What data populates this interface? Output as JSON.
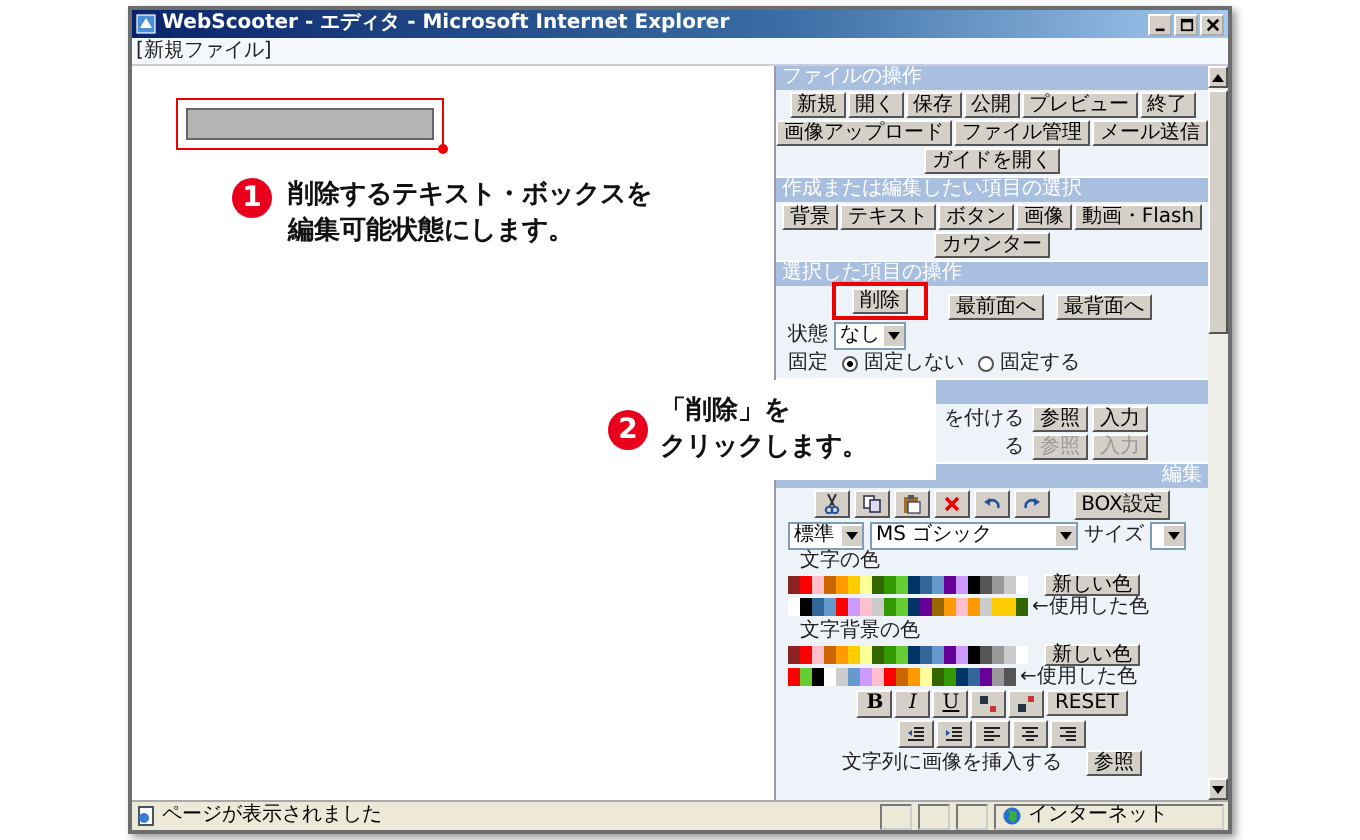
{
  "window": {
    "title": "WebScooter - エディタ - Microsoft Internet Explorer"
  },
  "file_label": "[新規ファイル]",
  "canvas": {
    "textbox": {
      "highlighted": true
    }
  },
  "callouts": [
    {
      "number": "1",
      "lines": [
        "削除するテキスト・ボックスを",
        "編集可能状態にします。"
      ]
    },
    {
      "number": "2",
      "lines": [
        "「削除」を",
        "クリックします。"
      ]
    }
  ],
  "file_section": {
    "title": "ファイルの操作",
    "button_rows": [
      [
        "新規",
        "開く",
        "保存",
        "公開",
        "プレビュー",
        "終了"
      ],
      [
        "画像アップロード",
        "ファイル管理",
        "メール送信"
      ],
      [
        "ガイドを開く"
      ]
    ]
  },
  "item_section": {
    "title": "作成または編集したい項目の選択",
    "button_rows": [
      [
        "背景",
        "テキスト",
        "ボタン",
        "画像",
        "動画・Flash"
      ],
      [
        "カウンター"
      ]
    ]
  },
  "operation_section": {
    "title": "選択した項目の操作",
    "buttons": [
      {
        "label": "削除",
        "highlighted": true
      },
      {
        "label": "最前面へ",
        "highlighted": false
      },
      {
        "label": "最背面へ",
        "highlighted": false
      }
    ],
    "state_label": "状態",
    "state_value": "なし",
    "fixed_label": "固定",
    "fixed_options": [
      {
        "label": "固定しない",
        "selected": true
      },
      {
        "label": "固定する",
        "selected": false
      }
    ]
  },
  "link_section": {
    "rows": [
      {
        "label": "を付ける",
        "buttons": [
          {
            "label": "参照",
            "disabled": false
          },
          {
            "label": "入力",
            "disabled": false
          }
        ]
      },
      {
        "label": "る",
        "buttons": [
          {
            "label": "参照",
            "disabled": true
          },
          {
            "label": "入力",
            "disabled": true
          }
        ]
      }
    ]
  },
  "edit_section": {
    "title": "編集",
    "box_button": "BOX設定",
    "style_select": "標準",
    "font_select": "MS ゴシック",
    "size_label": "サイズ",
    "color_groups": [
      {
        "label": "文字の色",
        "new_button": "新しい色",
        "used_label": "←使用した色",
        "palette": [
          {
            "color": "#8b2323"
          },
          {
            "color": "#ff0000"
          },
          {
            "color": "#ffc0cb"
          },
          {
            "color": "#cc6600"
          },
          {
            "color": "#ff9900"
          },
          {
            "color": "#ffcc00"
          },
          {
            "color": "#ffff99"
          },
          {
            "color": "#336600"
          },
          {
            "color": "#339900"
          },
          {
            "color": "#66cc33"
          },
          {
            "color": "#003366"
          },
          {
            "color": "#336699"
          },
          {
            "color": "#6699cc"
          },
          {
            "color": "#660099"
          },
          {
            "color": "#cc99ff"
          },
          {
            "color": "#000000"
          },
          {
            "color": "#555555"
          },
          {
            "color": "#999999"
          },
          {
            "color": "#cccccc"
          },
          {
            "color": "#ffffff"
          }
        ],
        "used": [
          {
            "color": "#ffffff"
          },
          {
            "color": "#000000"
          },
          {
            "color": "#336699"
          },
          {
            "color": "#6699cc"
          },
          {
            "color": "#ff0000"
          },
          {
            "color": "#cc99ff"
          },
          {
            "color": "#ffc0cb"
          },
          {
            "color": "#cccccc"
          },
          {
            "color": "#339900"
          },
          {
            "color": "#66cc33"
          },
          {
            "color": "#003366"
          },
          {
            "color": "#660099"
          },
          {
            "color": "#996600"
          },
          {
            "color": "#ff9900"
          },
          {
            "color": "#ffc0cb"
          },
          {
            "color": "#ff9900"
          },
          {
            "color": "#cccccc"
          },
          {
            "color": "#ffcc00"
          },
          {
            "color": "#ffcc00"
          },
          {
            "color": "#336600"
          }
        ]
      },
      {
        "label": "文字背景の色",
        "new_button": "新しい色",
        "used_label": "←使用した色",
        "palette": [
          {
            "color": "#8b2323"
          },
          {
            "color": "#ff0000"
          },
          {
            "color": "#ffc0cb"
          },
          {
            "color": "#cc6600"
          },
          {
            "color": "#ff9900"
          },
          {
            "color": "#ffcc00"
          },
          {
            "color": "#ffff99"
          },
          {
            "color": "#336600"
          },
          {
            "color": "#339900"
          },
          {
            "color": "#66cc33"
          },
          {
            "color": "#003366"
          },
          {
            "color": "#336699"
          },
          {
            "color": "#6699cc"
          },
          {
            "color": "#660099"
          },
          {
            "color": "#cc99ff"
          },
          {
            "color": "#000000"
          },
          {
            "color": "#555555"
          },
          {
            "color": "#999999"
          },
          {
            "color": "#cccccc"
          },
          {
            "color": "#ffffff"
          }
        ],
        "used": [
          {
            "color": "#ff0000"
          },
          {
            "color": "#66cc33"
          },
          {
            "color": "#000000"
          },
          {
            "color": "#ffffff"
          },
          {
            "color": "#cccccc"
          },
          {
            "color": "#6699cc"
          },
          {
            "color": "#cc99ff"
          },
          {
            "color": "#ffc0cb"
          },
          {
            "color": "#ff0000"
          },
          {
            "color": "#cc6600"
          },
          {
            "color": "#ff9900"
          },
          {
            "color": "#ffff99"
          },
          {
            "color": "#336600"
          },
          {
            "color": "#339900"
          },
          {
            "color": "#003366"
          },
          {
            "color": "#336699"
          },
          {
            "color": "#660099"
          },
          {
            "color": "#999999"
          },
          {
            "color": "#555555"
          }
        ]
      }
    ],
    "format_buttons": [
      {
        "kind": "bold",
        "label": "B"
      },
      {
        "kind": "italic",
        "label": "I"
      },
      {
        "kind": "underline",
        "label": "U"
      }
    ],
    "reset_button": "RESET",
    "insert_label": "文字列に画像を挿入する",
    "insert_button": "参照"
  },
  "status_bar": {
    "message": "ページが表示されました",
    "zone": "インターネット"
  }
}
